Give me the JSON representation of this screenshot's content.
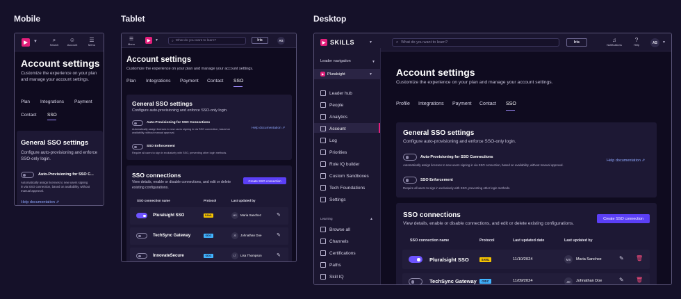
{
  "labels": {
    "mobile": "Mobile",
    "tablet": "Tablet",
    "desktop": "Desktop"
  },
  "colors": {
    "bg": "#151129",
    "frame": "#0f0b1f",
    "card": "#1d1834",
    "accent": "#e41f7b",
    "primary": "#5b3ff6",
    "toggle_on": "#6e54ff",
    "link": "#8fa8ff",
    "saml": "#f5c400",
    "oidc": "#40b4ff",
    "danger": "#ff4d7e"
  },
  "app": {
    "logo_text": "SKILLS",
    "search_placeholder": "What do you want to learn?",
    "iris": "Iris",
    "avatar": "AS",
    "notifications": "Notifications",
    "help": "Help",
    "menu": "Menu",
    "search": "Search",
    "account": "Account"
  },
  "page": {
    "title": "Account settings",
    "subtitle": "Customize the experience on your plan and manage your account settings.",
    "tabs": [
      "Profile",
      "Integrations",
      "Payment",
      "Contact",
      "SSO"
    ],
    "mobile_tabs": [
      "Plan",
      "Integrations",
      "Payment",
      "Contact",
      "SSO"
    ],
    "tablet_tabs": [
      "Plan",
      "Integrations",
      "Payment",
      "Contact",
      "SSO"
    ]
  },
  "general": {
    "title": "General SSO settings",
    "subtitle": "Configure auto-provisioning and enforce SSO-only login.",
    "auto_title": "Auto-Provisioning for SSO Connections",
    "auto_title_mobile": "Auto-Provisioning for SSO C...",
    "auto_desc": "Automatically assign licenses to new users signing in via SSO connection, based on availability, without manual approval.",
    "help": "Help documentation",
    "enf_title": "SSO Enforcement",
    "enf_desc": "Require all users to sign in exclusively with SSO, preventing other login methods."
  },
  "connections": {
    "title": "SSO connections",
    "subtitle": "View details, enable or disable connections, and edit or delete existing configurations.",
    "create": "Create SSO connection",
    "headers": {
      "name": "SSO connection name",
      "protocol": "Protocol",
      "date": "Last updated date",
      "by": "Last updated by"
    },
    "rows": [
      {
        "name": "Pluralsight SSO",
        "protocol": "SAML",
        "date": "11/10/2024",
        "initials": "MS",
        "by": "Maria Sanchez"
      },
      {
        "name": "TechSync Gateway",
        "protocol": "OIDC",
        "date": "11/09/2024",
        "initials": "JD",
        "by": "Johnathan Doe"
      },
      {
        "name": "InnovateSecure",
        "protocol": "OIDC",
        "date": "",
        "initials": "LT",
        "by": "Lisa Thompson"
      }
    ]
  },
  "sidebar": {
    "leader_nav": "Leader navigation",
    "org": "Pluralsight",
    "items": [
      "Leader hub",
      "People",
      "Analytics",
      "Account",
      "Log",
      "Priorities",
      "Role IQ builder",
      "Custom Sandboxes",
      "Tech Foundations",
      "Settings"
    ],
    "learning": "Learning",
    "learning_items": [
      "Browse all",
      "Channels",
      "Certifications",
      "Paths",
      "Skill IQ"
    ]
  }
}
